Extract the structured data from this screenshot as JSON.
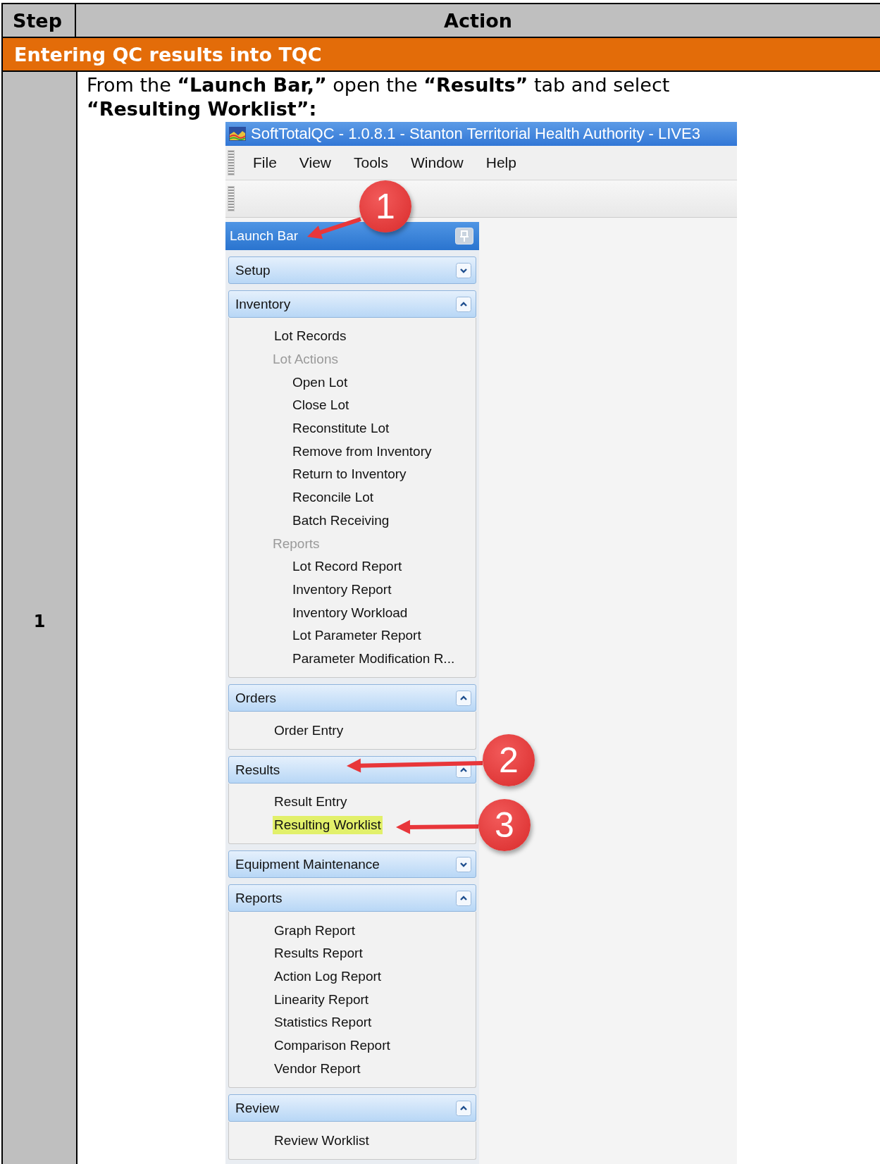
{
  "table": {
    "columns": [
      "Step",
      "Action"
    ],
    "section_heading": "Entering QC results into TQC",
    "rows": [
      {
        "step": "1",
        "instruction": "From the **“Launch Bar,”** open the **“Results”** tab and select **“Resulting Worklist”:**",
        "screenshot": {
          "window": {
            "title": "SoftTotalQC - 1.0.8.1 - Stanton Territorial Health Authority - LIVE3"
          },
          "menu": [
            "File",
            "View",
            "Tools",
            "Window",
            "Help"
          ],
          "launch_bar": {
            "title": "Launch Bar",
            "sections": [
              {
                "title": "Setup",
                "expanded": false
              },
              {
                "title": "Inventory",
                "expanded": true,
                "items": [
                  {
                    "label": "Lot Records",
                    "selected": false
                  },
                  {
                    "label": "Lot Actions",
                    "selected": false,
                    "children": [
                      {
                        "label": "Open Lot",
                        "selected": false
                      },
                      {
                        "label": "Close Lot",
                        "selected": false
                      },
                      {
                        "label": "Reconstitute Lot",
                        "selected": false
                      },
                      {
                        "label": "Remove from Inventory",
                        "selected": false
                      },
                      {
                        "label": "Return to Inventory",
                        "selected": false
                      },
                      {
                        "label": "Reconcile Lot",
                        "selected": false
                      },
                      {
                        "label": "Batch Receiving",
                        "selected": false
                      }
                    ]
                  },
                  {
                    "label": "Reports",
                    "selected": false,
                    "children": [
                      {
                        "label": "Lot Record Report",
                        "selected": false
                      },
                      {
                        "label": "Inventory Report",
                        "selected": false
                      },
                      {
                        "label": "Inventory Workload",
                        "selected": false
                      },
                      {
                        "label": "Lot Parameter Report",
                        "selected": false
                      },
                      {
                        "label": "Parameter Modification R...",
                        "selected": false
                      }
                    ]
                  }
                ]
              },
              {
                "title": "Orders",
                "expanded": true,
                "items": [
                  {
                    "label": "Order Entry",
                    "selected": false
                  }
                ]
              },
              {
                "title": "Results",
                "expanded": true,
                "items": [
                  {
                    "label": "Result Entry",
                    "selected": false
                  },
                  {
                    "label": "Resulting Worklist",
                    "selected": true
                  }
                ]
              },
              {
                "title": "Equipment Maintenance",
                "expanded": false
              },
              {
                "title": "Reports",
                "expanded": true,
                "items": [
                  {
                    "label": "Graph Report",
                    "selected": false
                  },
                  {
                    "label": "Results Report",
                    "selected": false
                  },
                  {
                    "label": "Action Log Report",
                    "selected": false
                  },
                  {
                    "label": "Linearity Report",
                    "selected": false
                  },
                  {
                    "label": "Statistics Report",
                    "selected": false
                  },
                  {
                    "label": "Comparison Report",
                    "selected": false
                  },
                  {
                    "label": "Vendor Report",
                    "selected": false
                  }
                ]
              },
              {
                "title": "Review",
                "expanded": true,
                "items": [
                  {
                    "label": "Review Worklist",
                    "selected": false
                  }
                ]
              }
            ]
          },
          "callouts": [
            "1",
            "2",
            "3"
          ]
        }
      }
    ]
  }
}
